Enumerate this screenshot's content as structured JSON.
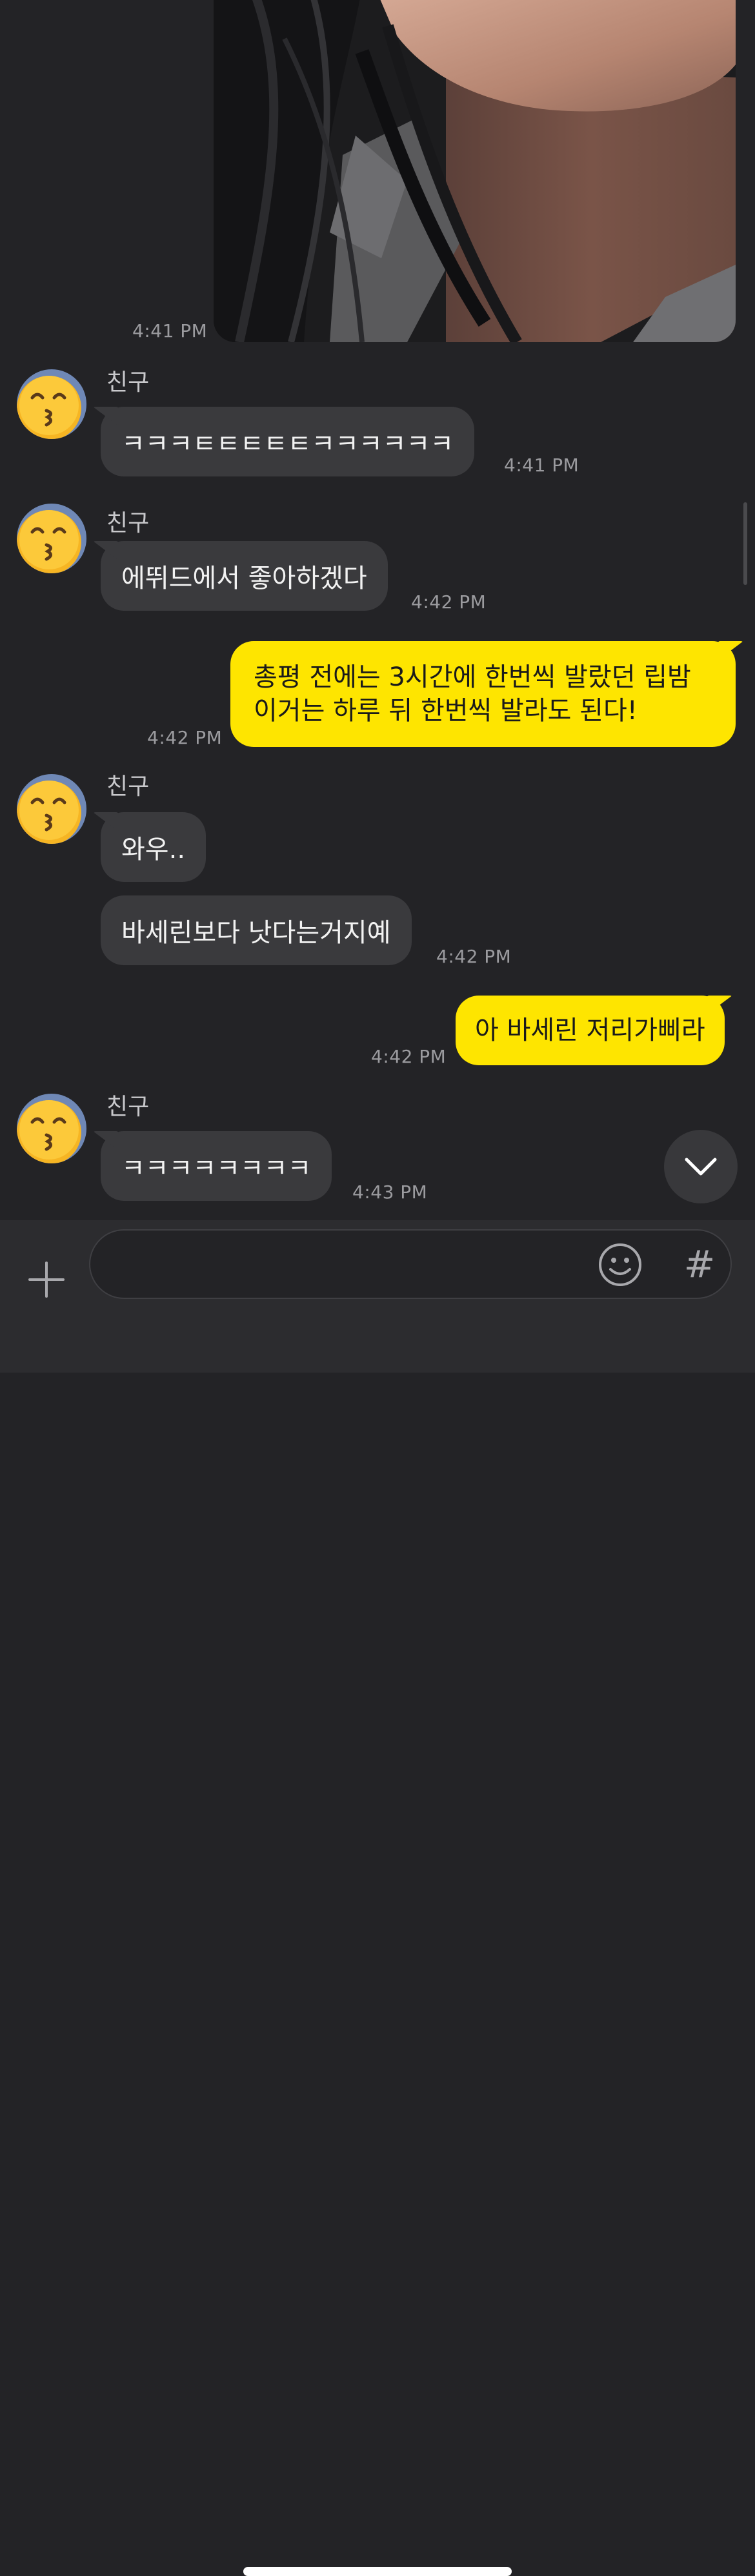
{
  "chat": {
    "photo_message": {
      "time": "4:41 PM"
    },
    "messages": [
      {
        "sender": "친구",
        "bubbles": [
          "ㅋㅋㅋㅌㅌㅌㅌㅌㅋㅋㅋㅋㅋㅋ"
        ],
        "time": "4:41 PM"
      },
      {
        "sender": "친구",
        "bubbles": [
          "에뛰드에서 좋아하겠다"
        ],
        "time": "4:42 PM"
      },
      {
        "mine": true,
        "lines": [
          "총평 전에는 3시간에 한번씩 발랐던 립밤",
          "이거는 하루 뒤 한번씩 발라도 된다!"
        ],
        "time": "4:42 PM"
      },
      {
        "sender": "친구",
        "bubbles": [
          "와우..",
          "바세린보다 낫다는거지예"
        ],
        "time": "4:42 PM"
      },
      {
        "mine": true,
        "lines": [
          "아 바세린 저리가삐라"
        ],
        "time": "4:42 PM"
      },
      {
        "sender": "친구",
        "bubbles": [
          "ㅋㅋㅋㅋㅋㅋㅋㅋ"
        ],
        "time": "4:43 PM"
      }
    ]
  },
  "icons": {
    "avatar": "kissing-face-emoji-icon",
    "scroll_down": "chevron-down-icon",
    "plus": "plus-icon",
    "emoji": "smiley-icon",
    "hash": "hash-icon"
  },
  "composer": {
    "placeholder": "",
    "hash_label": "#"
  },
  "colors": {
    "background": "#232326",
    "incoming_bubble": "#3a3a3d",
    "outgoing_bubble": "#fee500"
  }
}
